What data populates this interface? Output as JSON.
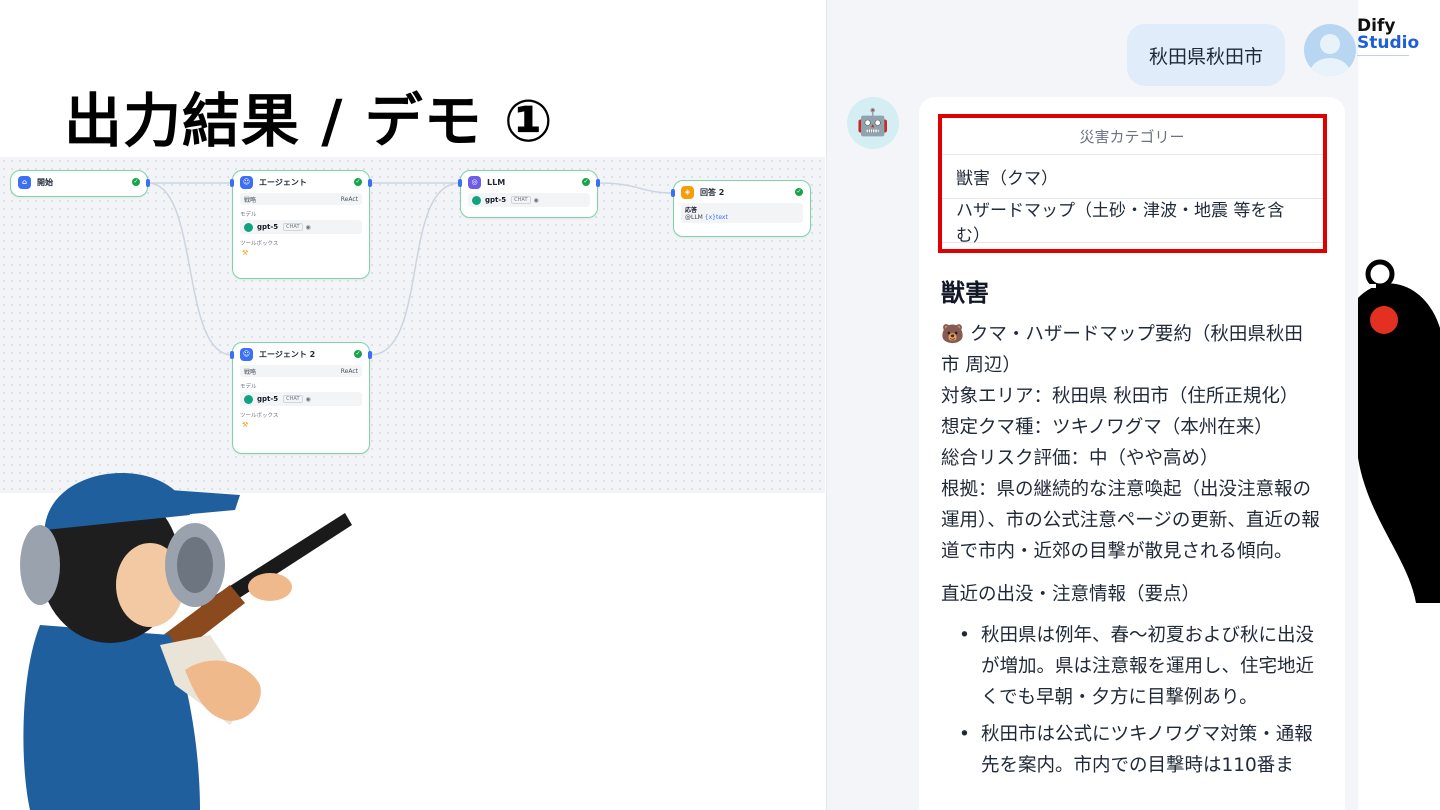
{
  "slide": {
    "title": "出力結果 / デモ ①"
  },
  "logo": {
    "line1": "Dify",
    "line2": "Studio"
  },
  "workflow": {
    "nodes": {
      "start": {
        "title": "開始"
      },
      "agent1": {
        "title": "エージェント",
        "strategy_label": "戦略",
        "strategy_value": "ReAct",
        "model_label": "モデル",
        "model": "gpt-5",
        "model_tag": "CHAT",
        "toolbox_label": "ツールボックス"
      },
      "llm": {
        "title": "LLM",
        "model": "gpt-5",
        "model_tag": "CHAT"
      },
      "answer": {
        "title": "回答 2",
        "field_label": "応答",
        "value_prefix": "@LLM",
        "value_var": "{x}text"
      },
      "agent2": {
        "title": "エージェント 2",
        "strategy_label": "戦略",
        "strategy_value": "ReAct",
        "model_label": "モデル",
        "model": "gpt-5",
        "model_tag": "CHAT",
        "toolbox_label": "ツールボックス"
      }
    }
  },
  "chat": {
    "user_message": "秋田県秋田市",
    "category_table": {
      "header": "災害カテゴリー",
      "rows": [
        "獣害（クマ）",
        "ハザードマップ（土砂・津波・地震 等を含む）"
      ]
    },
    "section_title": "獣害",
    "body": {
      "lines": [
        "🐻 クマ・ハザードマップ要約（秋田県秋田市 周辺）",
        "対象エリア：秋田県 秋田市（住所正規化）",
        "想定クマ種：ツキノワグマ（本州在来）",
        "総合リスク評価：中（やや高め）",
        "根拠：県の継続的な注意喚起（出没注意報の運用）、市の公式注意ページの更新、直近の報道で市内・近郊の目撃が散見される傾向。"
      ],
      "subheading": "直近の出没・注意情報（要点）",
      "bullets": [
        "秋田県は例年、春〜初夏および秋に出没が増加。県は注意報を運用し、住宅地近くでも早朝・夕方に目撃例あり。",
        "秋田市は公式にツキノワグマ対策・通報先を案内。市内での目撃時は110番ま"
      ]
    }
  },
  "colors": {
    "highlight_red": "#e10000",
    "node_border": "#7fd3a6",
    "user_bubble": "#e1ecfb",
    "logo_blue": "#1e5fd8"
  }
}
